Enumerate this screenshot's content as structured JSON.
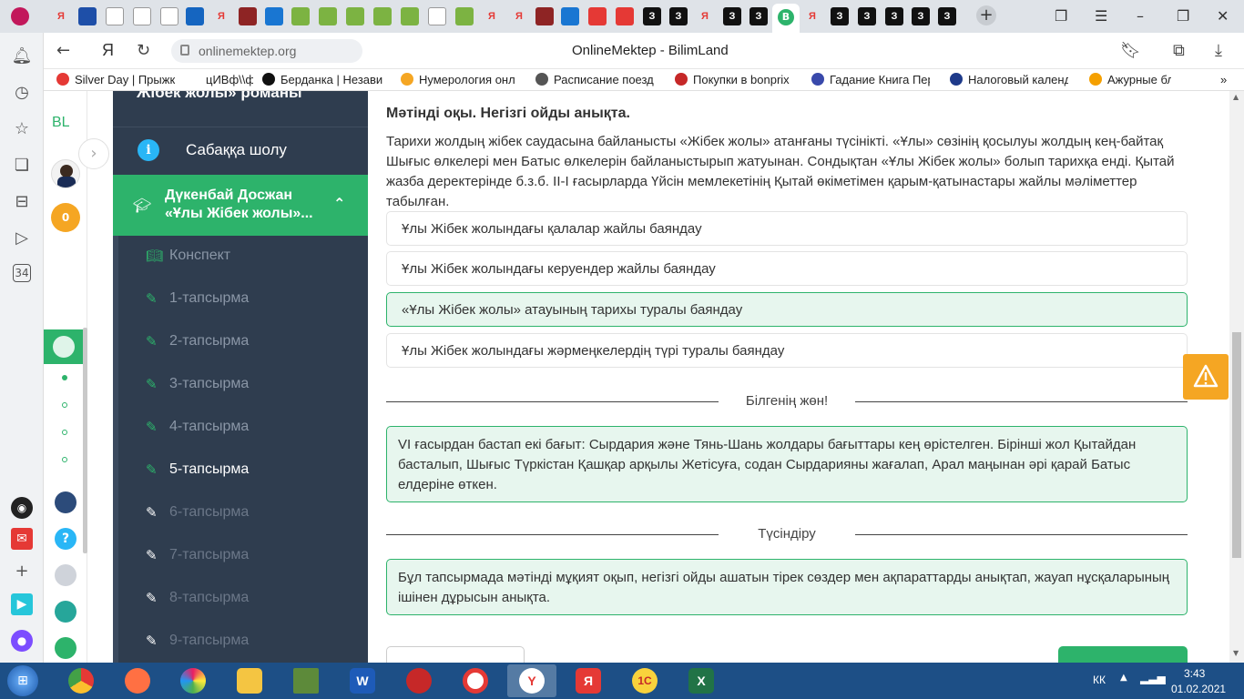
{
  "browser": {
    "url": "onlinemektep.org",
    "page_title": "OnlineMektep - BilimLand",
    "tab_glyphs": [
      "Я",
      "З"
    ]
  },
  "bookmarks": [
    {
      "label": "Silver Day | Прыжк",
      "color": "#e53935"
    },
    {
      "label": "цИВф\\\\ф ▾",
      "color": "#ffffff"
    },
    {
      "label": "Берданка | Незави",
      "color": "#111111"
    },
    {
      "label": "Нумерология онл",
      "color": "#f5a623"
    },
    {
      "label": "Расписание поезд",
      "color": "#555555"
    },
    {
      "label": "Покупки в bonprix",
      "color": "#c62828"
    },
    {
      "label": "Гадание Книга Пер",
      "color": "#3949ab"
    },
    {
      "label": "Налоговый календ",
      "color": "#1e3a8a"
    },
    {
      "label": "Ажурные бл",
      "color": "#f5a000"
    },
    {
      "label": "»",
      "color": "#ffffff"
    }
  ],
  "site_sidebar": {
    "logo": "BL",
    "coins": "0",
    "help": "?"
  },
  "course_nav": {
    "partial_title": "Жібек жолы» романы",
    "overview": "Сабаққа шолу",
    "lesson_title_line1": "Дүкенбай Досжан",
    "lesson_title_line2": "«Ұлы Жібек жолы»...",
    "items": [
      {
        "label": "Конспект",
        "icon": "book-icon",
        "state": "normal"
      },
      {
        "label": "1-тапсырма",
        "icon": "edit-icon",
        "state": "normal"
      },
      {
        "label": "2-тапсырма",
        "icon": "edit-icon",
        "state": "normal"
      },
      {
        "label": "3-тапсырма",
        "icon": "edit-icon",
        "state": "normal"
      },
      {
        "label": "4-тапсырма",
        "icon": "edit-icon",
        "state": "normal"
      },
      {
        "label": "5-тапсырма",
        "icon": "edit-icon",
        "state": "current"
      },
      {
        "label": "6-тапсырма",
        "icon": "edit-icon",
        "state": "locked"
      },
      {
        "label": "7-тапсырма",
        "icon": "edit-icon",
        "state": "locked"
      },
      {
        "label": "8-тапсырма",
        "icon": "edit-icon",
        "state": "locked"
      },
      {
        "label": "9-тапсырма",
        "icon": "edit-icon",
        "state": "locked"
      }
    ]
  },
  "task": {
    "instruction": "Мәтінді оқы. Негізгі ойды анықта.",
    "text": "Тарихи жолдың жібек саудасына байланысты «Жібек жолы» атанғаны түсінікті. «Ұлы» сөзінің қосылуы жолдың кең-байтақ Шығыс өлкелері мен Батыс өлкелерін байланыстырып жатуынан. Сондықтан «Ұлы Жібек жолы» болып тарихқа енді. Қытай жазба деректерінде б.з.б. ІІ-І ғасырларда Үйсін мемлекетінің Қытай өкіметімен қарым-қатынастары жайлы мәліметтер табылған.",
    "options": [
      {
        "label": "Ұлы Жібек жолындағы қалалар жайлы баяндау",
        "selected": false
      },
      {
        "label": "Ұлы Жібек жолындағы керуендер жайлы баяндау",
        "selected": false
      },
      {
        "label": "«Ұлы Жібек жолы» атауының тарихы туралы баяндау",
        "selected": true
      },
      {
        "label": "Ұлы Жібек жолындағы жәрмеңкелердің түрі туралы баяндау",
        "selected": false
      }
    ],
    "feedback_title": "Білгенің жөн!",
    "feedback_text": "VI ғасырдан бастап екі бағыт: Сырдария және Тянь-Шань жолдары бағыттары кең өрістелген. Бірінші жол Қытайдан басталып, Шығыс Түркістан Қашқар арқылы Жетісуға, содан Сырдарияны жағалап, Арал маңынан әрі қарай Батыс елдеріне өткен.",
    "explain_title": "Түсіндіру",
    "explain_text": "Бұл тапсырмада мәтінді мұқият оқып, негізгі ойды ашатын тірек сөздер мен ақпараттарды анықтап, жауап нұсқаларының ішінен дұрысын анықта."
  },
  "taskbar": {
    "lang": "КК",
    "time": "3:43",
    "date": "01.02.2021"
  },
  "colors": {
    "accent_green": "#2db36b",
    "nav_dark": "#2f3d4f",
    "warning_orange": "#f5a623",
    "taskbar_blue": "#1d4f86"
  }
}
